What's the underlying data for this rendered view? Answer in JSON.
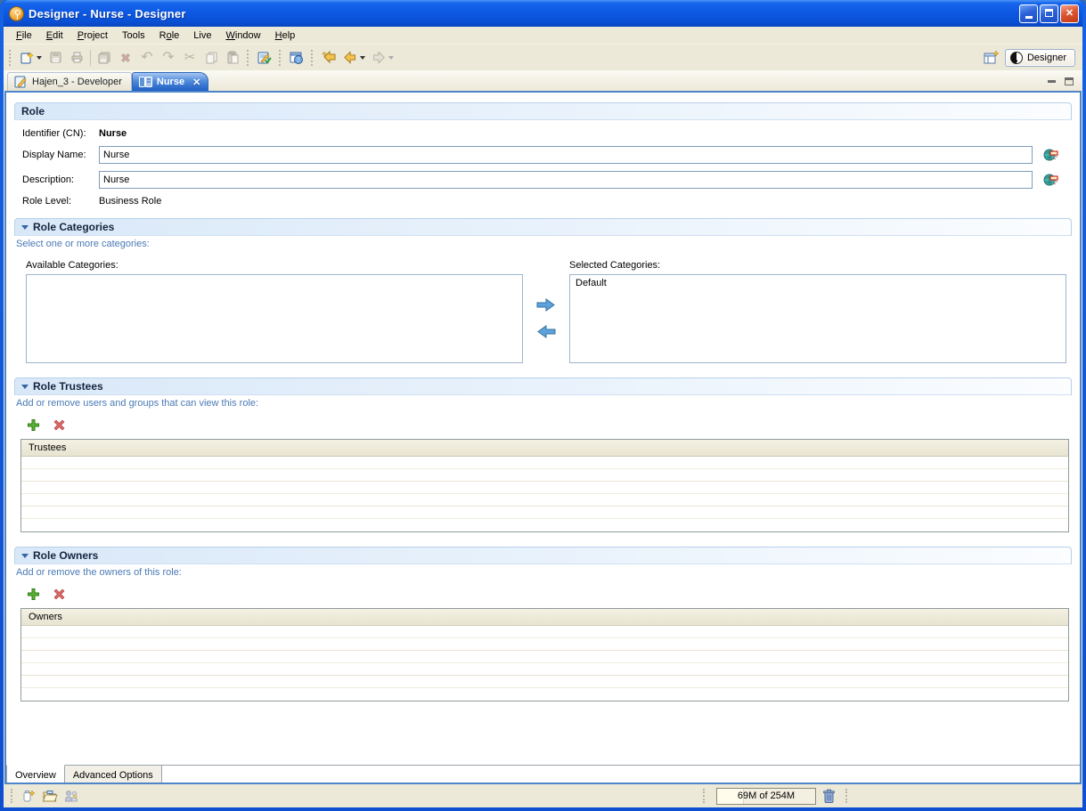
{
  "window": {
    "title": "Designer - Nurse - Designer"
  },
  "menu": {
    "items": [
      {
        "label": "File",
        "mnemonic": "F"
      },
      {
        "label": "Edit",
        "mnemonic": "E"
      },
      {
        "label": "Project",
        "mnemonic": "P"
      },
      {
        "label": "Tools",
        "mnemonic": ""
      },
      {
        "label": "Role",
        "mnemonic": "o"
      },
      {
        "label": "Live",
        "mnemonic": ""
      },
      {
        "label": "Window",
        "mnemonic": "W"
      },
      {
        "label": "Help",
        "mnemonic": "H"
      }
    ]
  },
  "toolbar": {
    "icons": [
      "new-wizard",
      "save",
      "print",
      "save-all",
      "delete",
      "undo",
      "redo",
      "cut",
      "copy",
      "paste",
      "validate-project",
      "web-browser",
      "last-edit-location",
      "back",
      "forward"
    ]
  },
  "perspective_bar": {
    "active_perspective": "Designer"
  },
  "editor_tabs": [
    {
      "label": "Hajen_3 - Developer",
      "active": false
    },
    {
      "label": "Nurse",
      "active": true
    }
  ],
  "role_form": {
    "header": "Role",
    "identifier_label": "Identifier (CN):",
    "identifier_value": "Nurse",
    "display_name_label": "Display Name:",
    "display_name_value": "Nurse",
    "description_label": "Description:",
    "description_value": "Nurse",
    "role_level_label": "Role Level:",
    "role_level_value": "Business Role"
  },
  "role_categories": {
    "header": "Role Categories",
    "instruction": "Select one or more categories:",
    "available_label": "Available Categories:",
    "available_items": [],
    "selected_label": "Selected Categories:",
    "selected_items": [
      "Default"
    ]
  },
  "role_trustees": {
    "header": "Role Trustees",
    "instruction": "Add or remove users and groups that can view this role:",
    "table_header": "Trustees",
    "rows": []
  },
  "role_owners": {
    "header": "Role Owners",
    "instruction": "Add or remove the owners of this role:",
    "table_header": "Owners",
    "rows": []
  },
  "bottom_tabs": [
    {
      "label": "Overview",
      "active": true
    },
    {
      "label": "Advanced Options",
      "active": false
    }
  ],
  "status_bar": {
    "memory_usage": "69M of 254M"
  },
  "colors": {
    "titlebar_blue": "#0d59e3",
    "editor_border_blue": "#4e85c9",
    "active_tab_blue": "#1f5fc4",
    "chrome_beige": "#ece9d8",
    "instruction_blue": "#4a7ab5",
    "section_header_blue": "#d9e8f8"
  }
}
